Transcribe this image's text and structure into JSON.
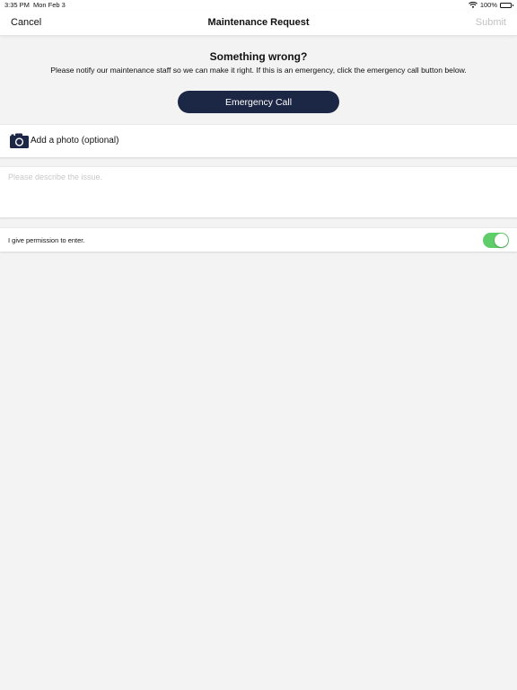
{
  "status_bar": {
    "time": "3:35 PM",
    "date": "Mon Feb 3",
    "battery": "100%",
    "battery_level": 1.0
  },
  "nav": {
    "cancel_label": "Cancel",
    "title": "Maintenance Request",
    "submit_label": "Submit"
  },
  "intro": {
    "heading": "Something wrong?",
    "description": "Please notify our maintenance staff so we can make it right. If this is an emergency, click the emergency call button below.",
    "emergency_button_label": "Emergency Call"
  },
  "photo": {
    "label": "Add a photo (optional)",
    "icon": "camera-icon"
  },
  "issue": {
    "placeholder": "Please describe the issue.",
    "value": ""
  },
  "permission": {
    "label": "I give permission to enter.",
    "enabled": true
  },
  "colors": {
    "accent_dark": "#1c2645",
    "toggle_on": "#5fce6a",
    "background": "#f3f3f3",
    "submit_disabled": "#c2c2c2"
  }
}
